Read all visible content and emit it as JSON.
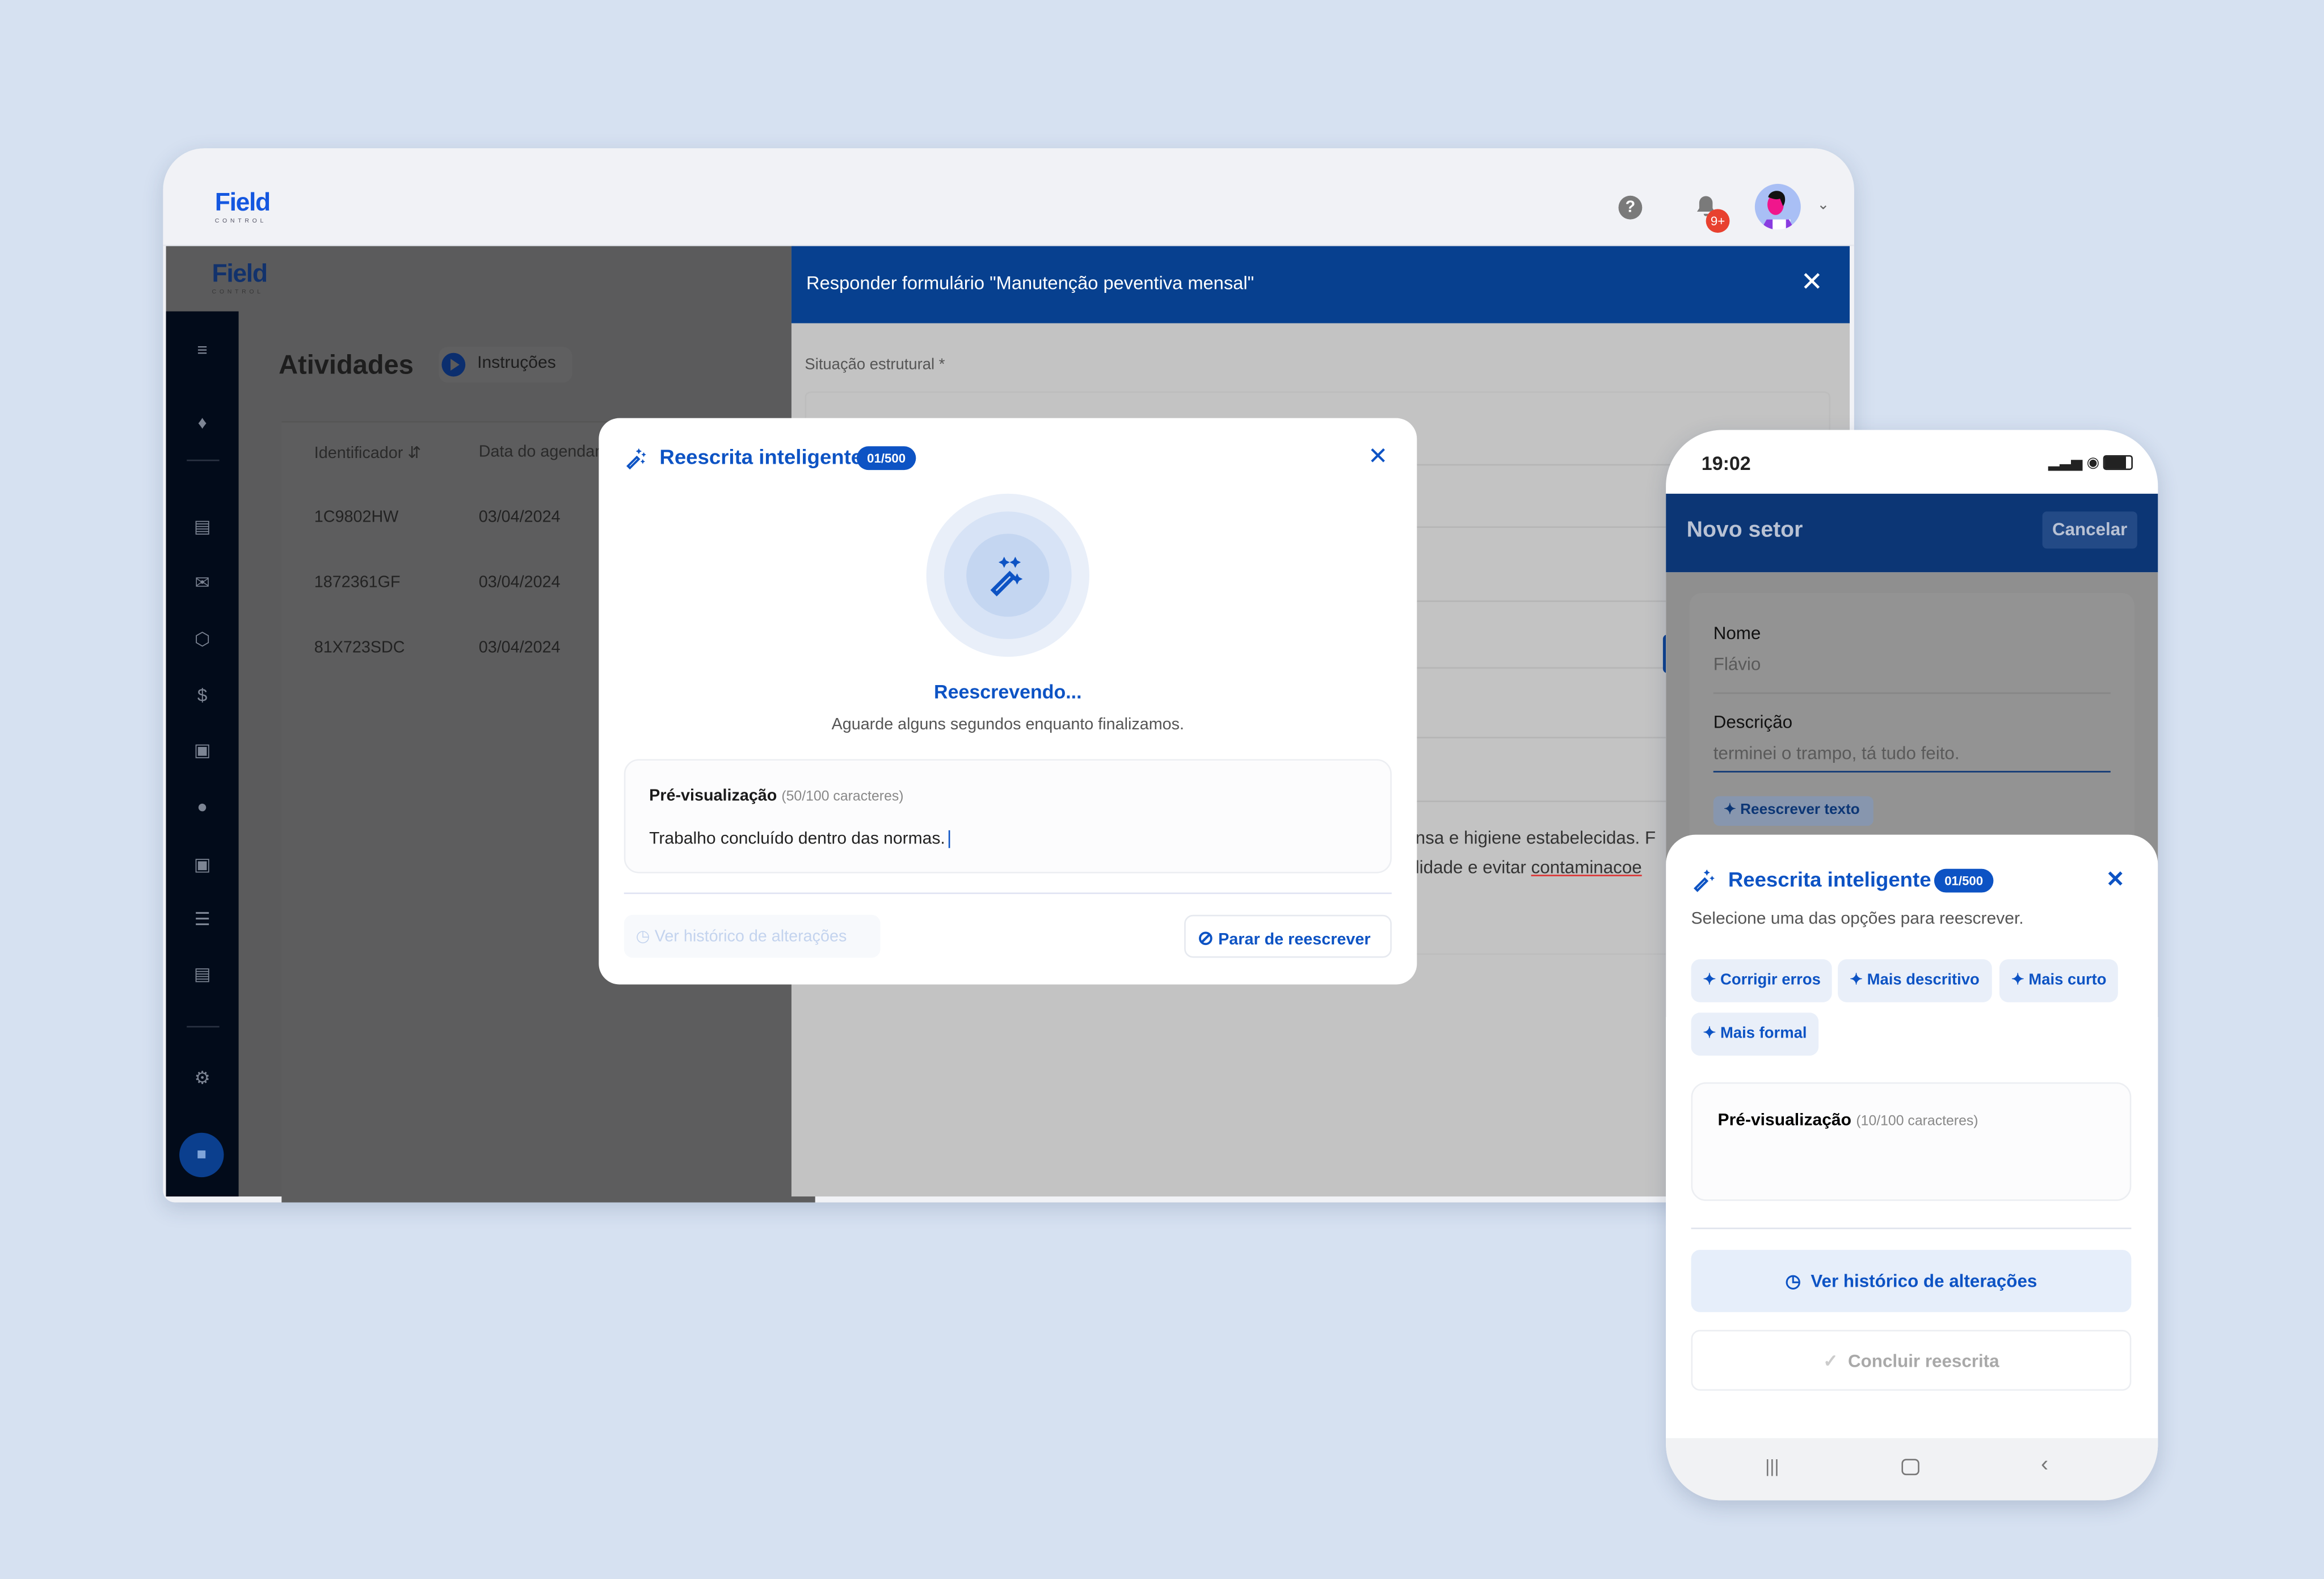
{
  "colors": {
    "background": "#d6e1f1",
    "primary": "#0d53c4",
    "header_blue": "#07408f",
    "badge_red": "#e8412f"
  },
  "desktop": {
    "logo": {
      "word": "Field",
      "sub": "CONTROL"
    },
    "header": {
      "notification_badge": "9+",
      "icons": [
        "help-icon",
        "bell-icon",
        "avatar",
        "chevron-down-icon"
      ]
    },
    "page": {
      "title": "Atividades",
      "instructions_button": "Instruções",
      "table": {
        "columns": [
          "Identificador",
          "Data do agendamento"
        ],
        "rows": [
          [
            "1C9802HW",
            "03/04/2024"
          ],
          [
            "1872361GF",
            "03/04/2024"
          ],
          [
            "81X723SDC",
            "03/04/2024"
          ]
        ]
      }
    },
    "sidebar": {
      "icons": [
        "collapse-icon",
        "bell-icon",
        "clipboard-icon",
        "mail-icon",
        "box-icon",
        "dollar-icon",
        "contact-icon",
        "location-icon",
        "car-icon",
        "server-icon",
        "chart-icon",
        "gear-icon",
        "chat-icon"
      ]
    },
    "form": {
      "title": "Responder formulário \"Manutenção peventiva mensal\"",
      "field_label": "Situação estrutural *",
      "text_line1": "nsa e higiene estabelecidas. F",
      "text_line2_a": "lidade e evitar ",
      "text_line2_b": "contaminacoe"
    }
  },
  "modal": {
    "title": "Reescrita inteligente",
    "badge": "01/500",
    "status": "Reescrevendo...",
    "subtitle": "Aguarde alguns segundos enquanto finalizamos.",
    "preview_label": "Pré-visualização",
    "preview_count": "(50/100 caracteres)",
    "preview_text": "Trabalho concluído dentro das normas.",
    "history_button": "Ver histórico de alterações",
    "stop_button": "Parar de reescrever"
  },
  "phone": {
    "time": "19:02",
    "header_title": "Novo setor",
    "cancel": "Cancelar",
    "fields": [
      {
        "label": "Nome",
        "value": "Flávio"
      },
      {
        "label": "Descrição",
        "value": "terminei o trampo, tá tudo feito."
      }
    ],
    "rewrite_chip": "Reescrever texto",
    "sheet": {
      "title": "Reescrita inteligente",
      "badge": "01/500",
      "subtitle": "Selecione uma das opções para reescrever.",
      "options": [
        "Corrigir erros",
        "Mais descritivo",
        "Mais curto",
        "Mais formal"
      ],
      "preview_label": "Pré-visualização",
      "preview_count": "(10/100 caracteres)",
      "history_button": "Ver histórico de alterações",
      "finish_button": "Concluir reescrita"
    }
  }
}
